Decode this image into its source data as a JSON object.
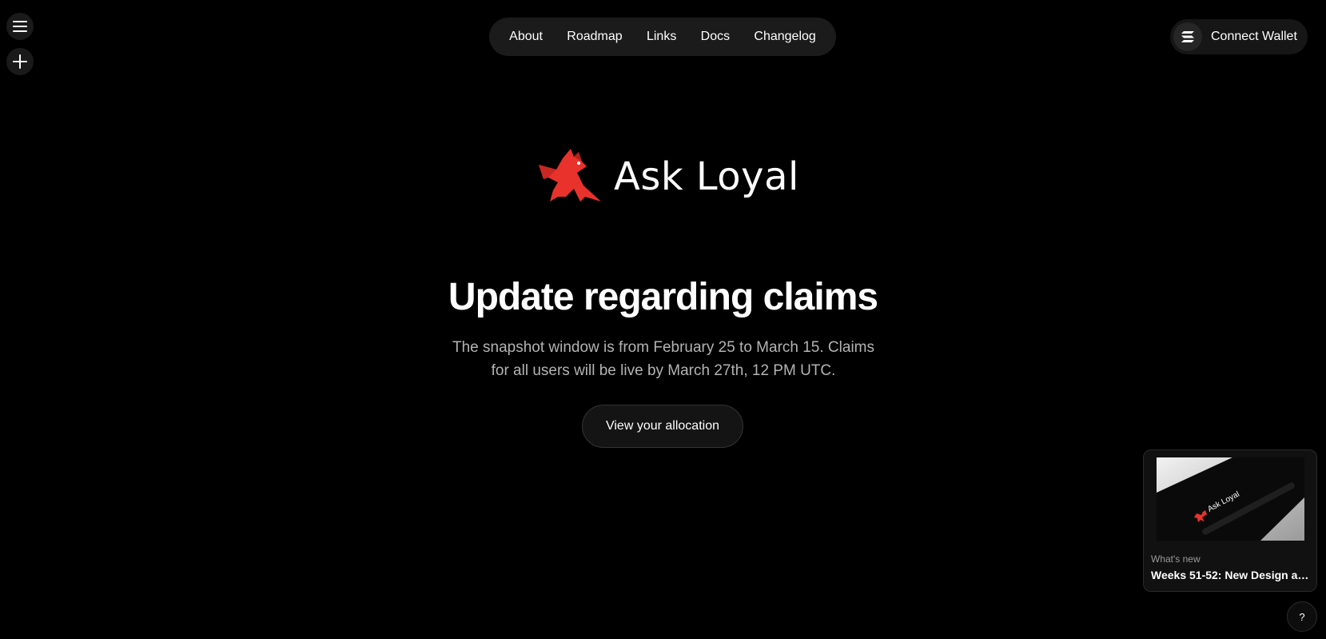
{
  "rail": {
    "menu_icon": "hamburger-menu-icon",
    "new_icon": "plus-icon"
  },
  "nav": {
    "items": [
      {
        "label": "About"
      },
      {
        "label": "Roadmap"
      },
      {
        "label": "Links"
      },
      {
        "label": "Docs"
      },
      {
        "label": "Changelog"
      }
    ]
  },
  "wallet": {
    "label": "Connect Wallet",
    "icon": "solana-icon"
  },
  "logo": {
    "text": "Ask Loyal",
    "icon": "red-fox-logo-icon",
    "color": "#e8322b"
  },
  "hero": {
    "title": "Update regarding claims",
    "description": "The snapshot window is from February 25 to March 15. Claims for all users will be live by March 27th, 12 PM UTC.",
    "cta_label": "View your allocation"
  },
  "news": {
    "kicker": "What's new",
    "title": "Weeks 51-52: New Design an...",
    "thumb_text": "Ask Loyal"
  },
  "help": {
    "label": "?"
  },
  "colors": {
    "background": "#000000",
    "surface": "#1b1b1b",
    "muted_text": "#b3b3b3",
    "accent": "#e8322b"
  }
}
